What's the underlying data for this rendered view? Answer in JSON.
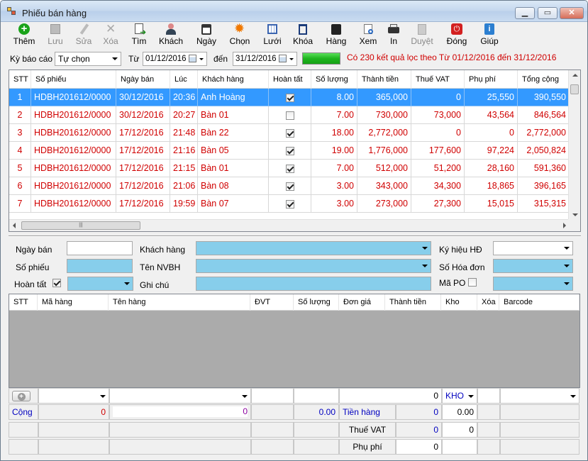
{
  "window": {
    "title": "Phiếu bán hàng"
  },
  "toolbar": [
    {
      "label": "Thêm",
      "icon": "add-icon",
      "enabled": true
    },
    {
      "label": "Lưu",
      "icon": "save-icon",
      "enabled": false
    },
    {
      "label": "Sửa",
      "icon": "edit-icon",
      "enabled": false
    },
    {
      "label": "Xóa",
      "icon": "delete-icon",
      "enabled": false
    },
    {
      "label": "Tìm",
      "icon": "find-icon",
      "enabled": true
    },
    {
      "label": "Khách",
      "icon": "customer-icon",
      "enabled": true
    },
    {
      "label": "Ngày",
      "icon": "calendar-icon",
      "enabled": true
    },
    {
      "label": "Chọn",
      "icon": "gear-icon",
      "enabled": true
    },
    {
      "label": "Lưới",
      "icon": "grid-icon",
      "enabled": true
    },
    {
      "label": "Khóa",
      "icon": "lock-icon",
      "enabled": true
    },
    {
      "label": "Hàng",
      "icon": "goods-icon",
      "enabled": true
    },
    {
      "label": "Xem",
      "icon": "preview-icon",
      "enabled": true
    },
    {
      "label": "In",
      "icon": "printer-icon",
      "enabled": true
    },
    {
      "label": "Duyệt",
      "icon": "approve-icon",
      "enabled": false
    },
    {
      "label": "Đóng",
      "icon": "power-icon",
      "enabled": true
    },
    {
      "label": "Giúp",
      "icon": "help-icon",
      "enabled": true
    }
  ],
  "filter": {
    "period_label": "Kỳ báo cáo",
    "period_value": "Tự chọn",
    "from_label": "Từ",
    "from_value": "01/12/2016",
    "to_label": "đến",
    "to_value": "31/12/2016",
    "result_text": "Có 230 kết quả lọc theo Từ 01/12/2016 đến 31/12/2016",
    "progress": 1.0
  },
  "orders": {
    "columns": [
      "STT",
      "Số phiếu",
      "Ngày bán",
      "Lúc",
      "Khách hàng",
      "Hoàn tất",
      "Số lượng",
      "Thành tiền",
      "Thuế VAT",
      "Phụ phí",
      "Tổng cộng"
    ],
    "rows": [
      {
        "stt": "1",
        "so": "HDBH201612/0000",
        "ngay": "30/12/2016",
        "luc": "20:36",
        "kh": "Anh Hoàng",
        "done": true,
        "sl": "8.00",
        "tt": "365,000",
        "vat": "0",
        "pp": "25,550",
        "tc": "390,550"
      },
      {
        "stt": "2",
        "so": "HDBH201612/0000",
        "ngay": "30/12/2016",
        "luc": "20:27",
        "kh": "Bàn 01",
        "done": false,
        "sl": "7.00",
        "tt": "730,000",
        "vat": "73,000",
        "pp": "43,564",
        "tc": "846,564"
      },
      {
        "stt": "3",
        "so": "HDBH201612/0000",
        "ngay": "17/12/2016",
        "luc": "21:48",
        "kh": "Bàn 22",
        "done": true,
        "sl": "18.00",
        "tt": "2,772,000",
        "vat": "0",
        "pp": "0",
        "tc": "2,772,000"
      },
      {
        "stt": "4",
        "so": "HDBH201612/0000",
        "ngay": "17/12/2016",
        "luc": "21:16",
        "kh": "Bàn 05",
        "done": true,
        "sl": "19.00",
        "tt": "1,776,000",
        "vat": "177,600",
        "pp": "97,224",
        "tc": "2,050,824"
      },
      {
        "stt": "5",
        "so": "HDBH201612/0000",
        "ngay": "17/12/2016",
        "luc": "21:15",
        "kh": "Bàn 01",
        "done": true,
        "sl": "7.00",
        "tt": "512,000",
        "vat": "51,200",
        "pp": "28,160",
        "tc": "591,360"
      },
      {
        "stt": "6",
        "so": "HDBH201612/0000",
        "ngay": "17/12/2016",
        "luc": "21:06",
        "kh": "Bàn 08",
        "done": true,
        "sl": "3.00",
        "tt": "343,000",
        "vat": "34,300",
        "pp": "18,865",
        "tc": "396,165"
      },
      {
        "stt": "7",
        "so": "HDBH201612/0000",
        "ngay": "17/12/2016",
        "luc": "19:59",
        "kh": "Bàn 07",
        "done": true,
        "sl": "3.00",
        "tt": "273,000",
        "vat": "27,300",
        "pp": "15,015",
        "tc": "315,315"
      }
    ]
  },
  "form": {
    "ngay_ban": "Ngày bán",
    "khach_hang": "Khách hàng",
    "ky_hieu": "Ký hiệu HĐ",
    "so_phieu": "Số phiếu",
    "ten_nvbh": "Tên NVBH",
    "so_hoa_don": "Số Hóa đơn",
    "hoan_tat": "Hoàn tất",
    "ghi_chu": "Ghi chú",
    "ma_po": "Mã PO"
  },
  "items": {
    "columns": [
      "STT",
      "Mã hàng",
      "Tên hàng",
      "ĐVT",
      "Số lượng",
      "Đơn giá",
      "Thành tiền",
      "Kho",
      "Xóa",
      "Barcode"
    ]
  },
  "footer": {
    "qty_zero": "0",
    "kho": "KHO",
    "cong_label": "Cộng",
    "cong_val1": "0",
    "cong_val2": "0",
    "cong_val3": "0.00",
    "tien_hang_label": "Tiền hàng",
    "tien_hang": "0",
    "tien_hang_pct": "0.00",
    "vat_label": "Thuế VAT",
    "vat_val": "0",
    "vat_pct": "0",
    "phu_phi_label": "Phụ phí",
    "phu_phi_val": "0"
  },
  "colors": {
    "row_text": "#d00000",
    "selected": "#3399ff",
    "field_blue": "#87ceeb"
  }
}
